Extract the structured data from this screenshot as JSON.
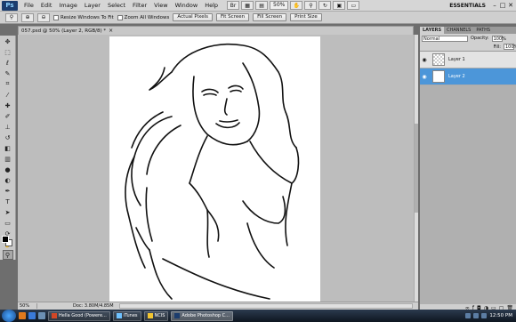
{
  "menubar": {
    "logo": "Ps",
    "items": [
      "File",
      "Edit",
      "Image",
      "Layer",
      "Select",
      "Filter",
      "View",
      "Window",
      "Help"
    ],
    "zoom": "50%",
    "workspace": "ESSENTIALS"
  },
  "options": {
    "resize_windows": "Resize Windows To Fit",
    "zoom_all": "Zoom All Windows",
    "actual_pixels": "Actual Pixels",
    "fit_screen": "Fit Screen",
    "fill_screen": "Fill Screen",
    "print_size": "Print Size"
  },
  "document": {
    "tab_title": "057.psd @ 50% (Layer 2, RGB/8) *",
    "status_zoom": "50%",
    "status_doc": "Doc: 3.80M/4.85M"
  },
  "layers_panel": {
    "tabs": [
      "LAYERS",
      "CHANNELS",
      "PATHS"
    ],
    "blend_mode": "Normal",
    "opacity_label": "Opacity:",
    "opacity": "100%",
    "fill_label": "Fill:",
    "fill": "100%",
    "layers": [
      {
        "name": "Layer 1",
        "active": false
      },
      {
        "name": "Layer 2",
        "active": true
      }
    ]
  },
  "taskbar": {
    "items": [
      "Hella Good (Powere...",
      "iTunes",
      "NCIS",
      "Adobe Photoshop C..."
    ],
    "time": "12:50 PM"
  },
  "colors": {
    "layer_selected": "#4c96d9",
    "foreground": "#000000",
    "background": "#ffffff"
  }
}
